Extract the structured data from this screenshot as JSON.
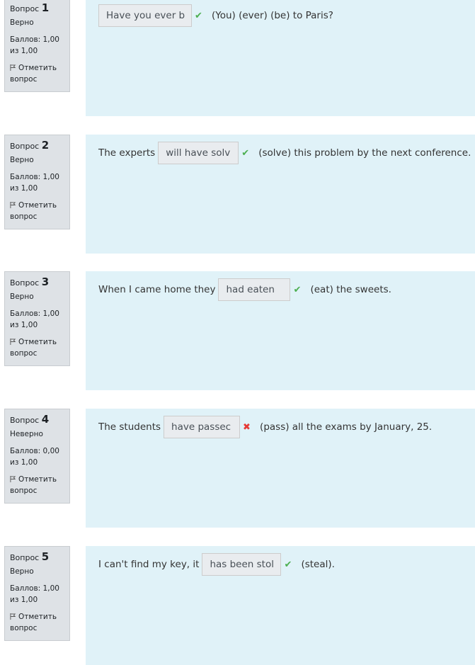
{
  "questions": [
    {
      "label": "Вопрос",
      "number": "1",
      "state": "Верно",
      "grade": "Баллов: 1,00 из 1,00",
      "flag_label": "Отметить вопрос",
      "before": "",
      "answer": "Have you ever b",
      "result": "correct",
      "after": "(You) (ever)  (be) to Paris?"
    },
    {
      "label": "Вопрос",
      "number": "2",
      "state": "Верно",
      "grade": "Баллов: 1,00 из 1,00",
      "flag_label": "Отметить вопрос",
      "before": "The experts",
      "answer": "will have solv",
      "result": "correct",
      "after": "(solve) this problem by the next conference."
    },
    {
      "label": "Вопрос",
      "number": "3",
      "state": "Верно",
      "grade": "Баллов: 1,00 из 1,00",
      "flag_label": "Отметить вопрос",
      "before": "When I came home they",
      "answer": "had eaten",
      "result": "correct",
      "after": "(eat) the sweets."
    },
    {
      "label": "Вопрос",
      "number": "4",
      "state": "Неверно",
      "grade": "Баллов: 0,00 из 1,00",
      "flag_label": "Отметить вопрос",
      "before": "The students",
      "answer": "have passec",
      "result": "incorrect",
      "after": "(pass) all the exams by January, 25."
    },
    {
      "label": "Вопрос",
      "number": "5",
      "state": "Верно",
      "grade": "Баллов: 1,00 из 1,00",
      "flag_label": "Отметить вопрос",
      "before": "I can't find my key, it",
      "answer": "has been stol",
      "result": "correct",
      "after": "(steal)."
    }
  ],
  "icons": {
    "correct": "check-icon",
    "incorrect": "cross-icon",
    "flag": "flag-icon"
  },
  "colors": {
    "content_bg": "#e0f2f8",
    "info_bg": "#dee2e6",
    "correct": "#4caf50",
    "incorrect": "#e53935"
  }
}
